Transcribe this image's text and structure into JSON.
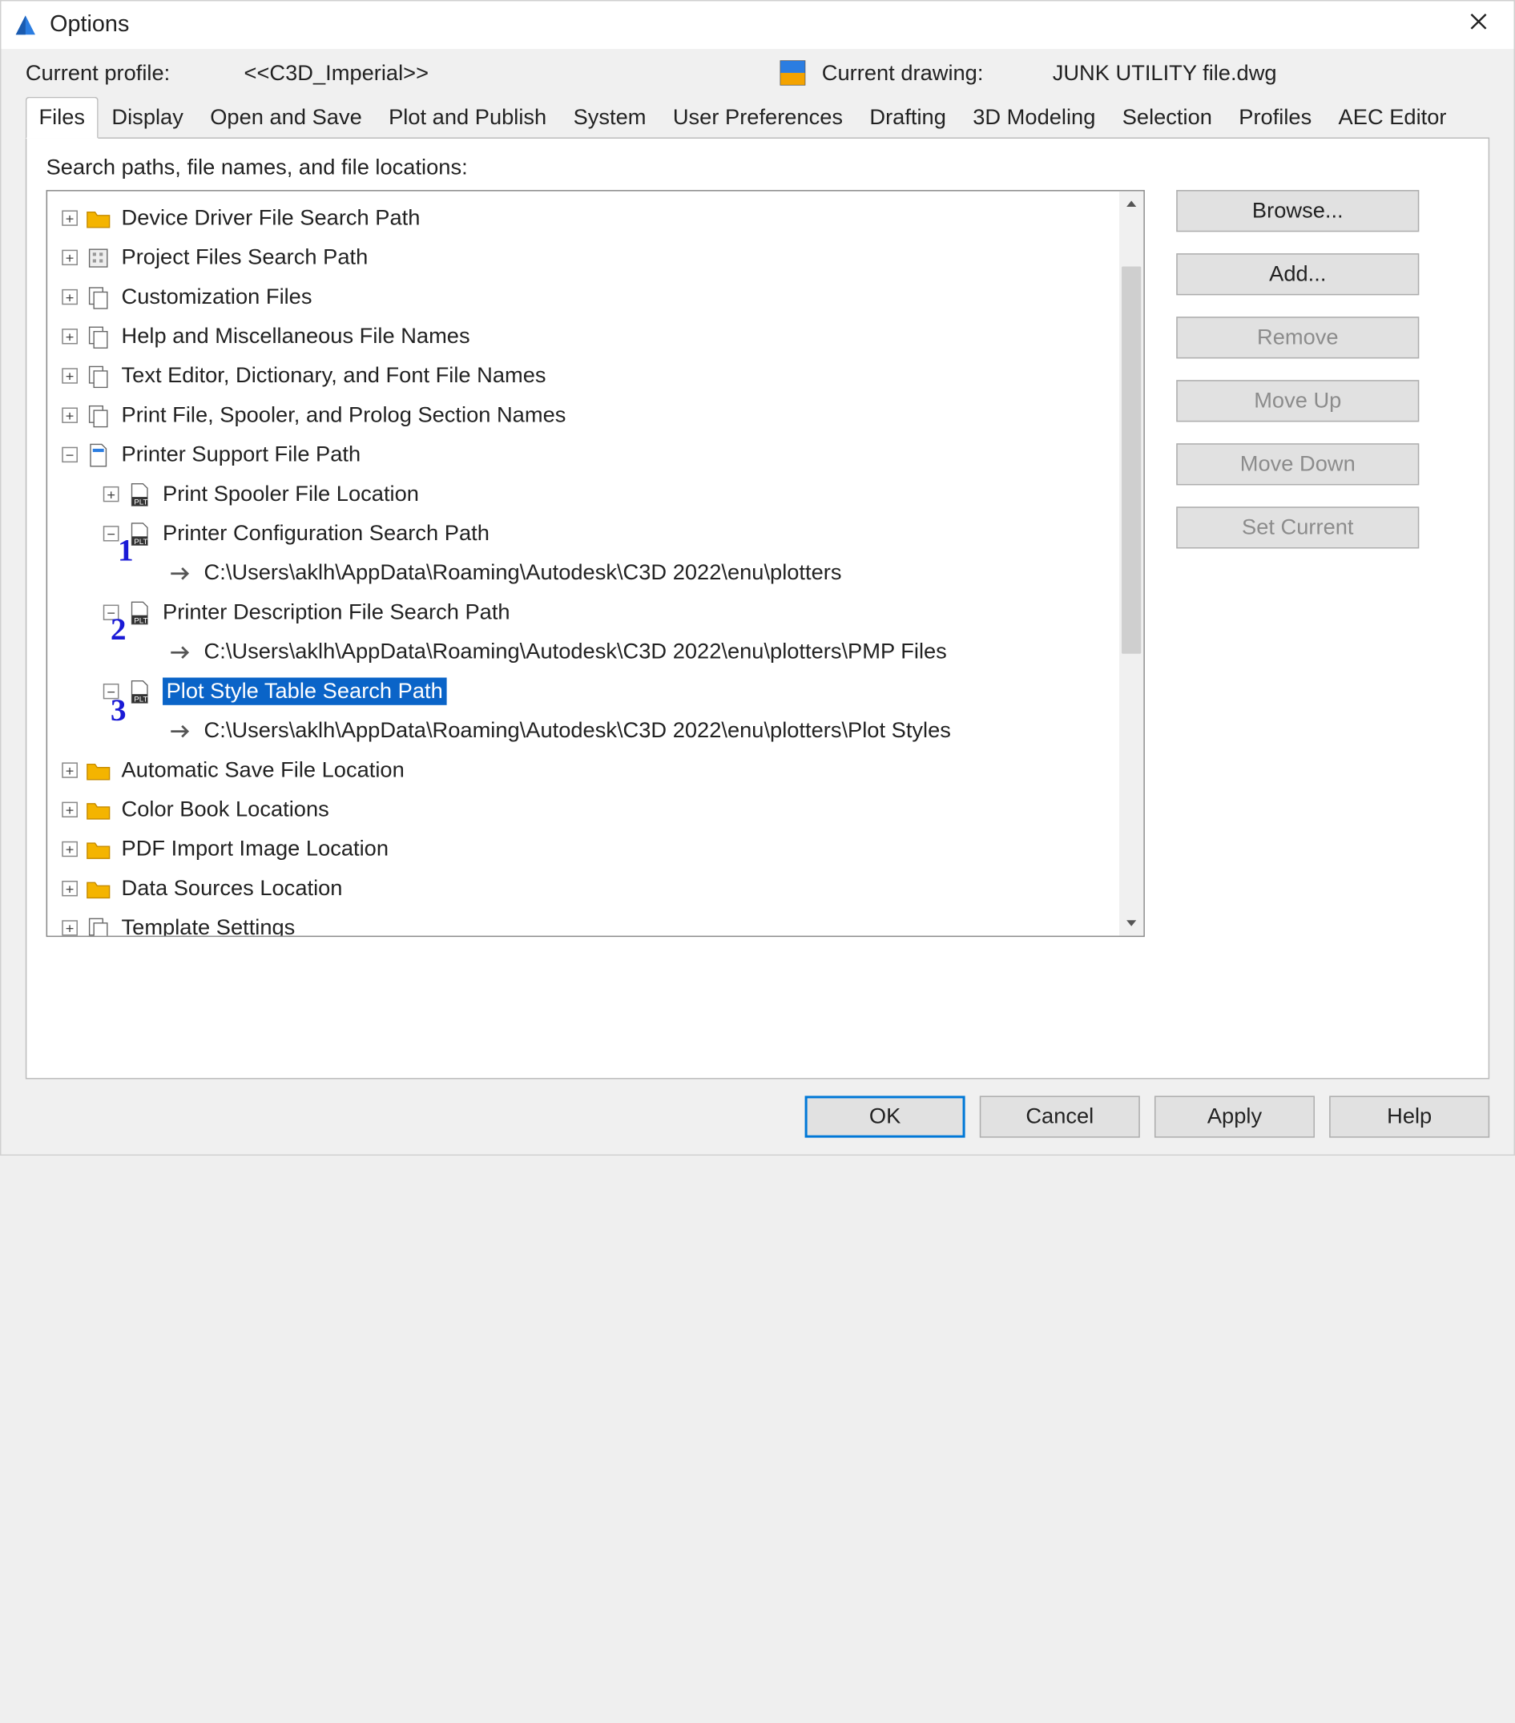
{
  "title": "Options",
  "header": {
    "profile_label": "Current profile:",
    "profile_value": "<<C3D_Imperial>>",
    "drawing_label": "Current drawing:",
    "drawing_value": "JUNK UTILITY file.dwg"
  },
  "tabs": [
    "Files",
    "Display",
    "Open and Save",
    "Plot and Publish",
    "System",
    "User Preferences",
    "Drafting",
    "3D Modeling",
    "Selection",
    "Profiles",
    "AEC Editor"
  ],
  "active_tab": "Files",
  "section_label": "Search paths, file names, and file locations:",
  "tree": [
    {
      "indent": 0,
      "exp": "+",
      "icon": "folder-yellow",
      "label": "Device Driver File Search Path"
    },
    {
      "indent": 0,
      "exp": "+",
      "icon": "db",
      "label": "Project Files Search Path"
    },
    {
      "indent": 0,
      "exp": "+",
      "icon": "files",
      "label": "Customization Files"
    },
    {
      "indent": 0,
      "exp": "+",
      "icon": "files",
      "label": "Help and Miscellaneous File Names"
    },
    {
      "indent": 0,
      "exp": "+",
      "icon": "files",
      "label": "Text Editor, Dictionary, and Font File Names"
    },
    {
      "indent": 0,
      "exp": "+",
      "icon": "files",
      "label": "Print File, Spooler, and Prolog Section Names"
    },
    {
      "indent": 0,
      "exp": "-",
      "icon": "file-blue",
      "label": "Printer Support File Path"
    },
    {
      "indent": 1,
      "exp": "+",
      "icon": "plt",
      "label": "Print Spooler File Location"
    },
    {
      "indent": 1,
      "exp": "-",
      "icon": "plt",
      "label": "Printer Configuration Search Path"
    },
    {
      "indent": 2,
      "exp": "",
      "icon": "arrow",
      "label": "C:\\Users\\aklh\\AppData\\Roaming\\Autodesk\\C3D 2022\\enu\\plotters"
    },
    {
      "indent": 1,
      "exp": "-",
      "icon": "plt",
      "label": "Printer Description File Search Path"
    },
    {
      "indent": 2,
      "exp": "",
      "icon": "arrow",
      "label": "C:\\Users\\aklh\\AppData\\Roaming\\Autodesk\\C3D 2022\\enu\\plotters\\PMP Files"
    },
    {
      "indent": 1,
      "exp": "-",
      "icon": "plt",
      "label": "Plot Style Table Search Path",
      "selected": true
    },
    {
      "indent": 2,
      "exp": "",
      "icon": "arrow",
      "label": "C:\\Users\\aklh\\AppData\\Roaming\\Autodesk\\C3D 2022\\enu\\plotters\\Plot Styles"
    },
    {
      "indent": 0,
      "exp": "+",
      "icon": "folder-yellow",
      "label": "Automatic Save File Location"
    },
    {
      "indent": 0,
      "exp": "+",
      "icon": "folder-yellow",
      "label": "Color Book Locations"
    },
    {
      "indent": 0,
      "exp": "+",
      "icon": "folder-yellow",
      "label": "PDF Import Image Location"
    },
    {
      "indent": 0,
      "exp": "+",
      "icon": "folder-yellow",
      "label": "Data Sources Location"
    },
    {
      "indent": 0,
      "exp": "+",
      "icon": "files",
      "label": "Template Settings"
    }
  ],
  "side_buttons": [
    {
      "label": "Browse...",
      "enabled": true
    },
    {
      "label": "Add...",
      "enabled": true
    },
    {
      "label": "Remove",
      "enabled": false
    },
    {
      "label": "Move Up",
      "enabled": false
    },
    {
      "label": "Move Down",
      "enabled": false
    },
    {
      "label": "Set Current",
      "enabled": false
    }
  ],
  "bottom_buttons": [
    "OK",
    "Cancel",
    "Apply",
    "Help"
  ],
  "annotations": [
    "1",
    "2",
    "3"
  ]
}
